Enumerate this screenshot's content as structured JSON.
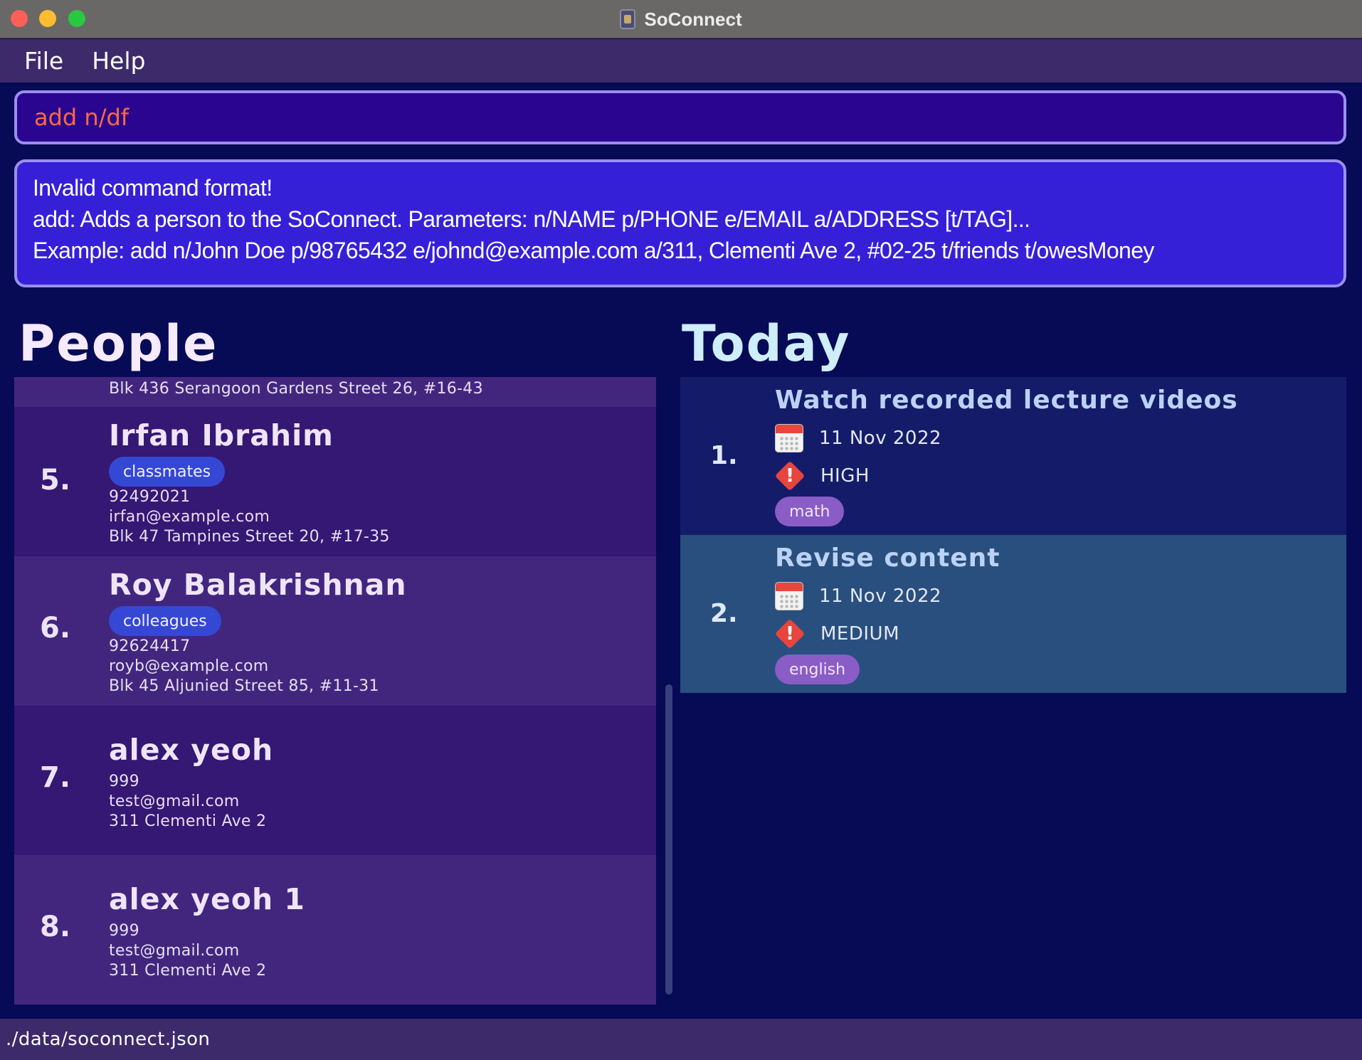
{
  "window": {
    "title": "SoConnect"
  },
  "menu": {
    "file": "File",
    "help": "Help"
  },
  "command": {
    "value": "add n/df"
  },
  "result": {
    "lines": [
      "Invalid command format!",
      "add: Adds a person to the SoConnect. Parameters: n/NAME p/PHONE e/EMAIL a/ADDRESS [t/TAG]...",
      "Example: add n/John Doe p/98765432 e/johnd@example.com a/311, Clementi Ave 2, #02-25 t/friends t/owesMoney"
    ]
  },
  "people": {
    "header": "People",
    "partial_address": "Blk 436 Serangoon Gardens Street 26, #16-43",
    "items": [
      {
        "index": "5.",
        "name": "Irfan Ibrahim",
        "tag": "classmates",
        "phone": "92492021",
        "email": "irfan@example.com",
        "address": "Blk 47 Tampines Street 20, #17-35"
      },
      {
        "index": "6.",
        "name": "Roy Balakrishnan",
        "tag": "colleagues",
        "phone": "92624417",
        "email": "royb@example.com",
        "address": "Blk 45 Aljunied Street 85, #11-31"
      },
      {
        "index": "7.",
        "name": "alex yeoh",
        "phone": "999",
        "email": "test@gmail.com",
        "address": "311 Clementi Ave 2"
      },
      {
        "index": "8.",
        "name": "alex yeoh 1",
        "phone": "999",
        "email": "test@gmail.com",
        "address": "311 Clementi Ave 2"
      }
    ]
  },
  "today": {
    "header": "Today",
    "tasks": [
      {
        "index": "1.",
        "title": "Watch recorded lecture videos",
        "date": "11 Nov 2022",
        "priority": "HIGH",
        "tag": "math"
      },
      {
        "index": "2.",
        "title": "Revise content",
        "date": "11 Nov 2022",
        "priority": "MEDIUM",
        "tag": "english"
      }
    ],
    "icons": {
      "date": "calendar-icon",
      "priority": "priority-icon"
    }
  },
  "status": {
    "path": "./data/soconnect.json"
  },
  "colors": {
    "accent": "#3520d8",
    "command_text": "#ff6a3d",
    "priority": "#e8453c"
  }
}
